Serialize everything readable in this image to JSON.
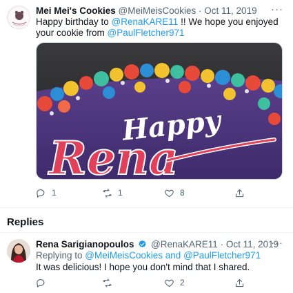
{
  "main_tweet": {
    "display_name": "Mei Mei's Cookies",
    "handle": "@MeiMeisCookies",
    "separator": "·",
    "date": "Oct 11, 2019",
    "more": "···",
    "text_before": "Happy birthday to ",
    "mention_1": "@RenaKARE11",
    "text_middle": " !! We hope you enjoyed your cookie from ",
    "mention_2": "@PaulFletcher971",
    "media_icon": "cake-photo",
    "actions": {
      "reply_count": "1",
      "retweet_count": "1",
      "like_count": "8"
    }
  },
  "replies_heading": "Replies",
  "reply_tweet": {
    "display_name": "Rena Sarigianopoulos",
    "handle": "@RenaKARE11",
    "separator": "·",
    "date": "Oct 11, 2019",
    "more": "···",
    "replying_prefix": "Replying to ",
    "replying_to_1": "@MeiMeisCookies",
    "replying_and": " and ",
    "replying_to_2": "@PaulFletcher971",
    "text": "It was delicious! I hope you don't mind that I shared.",
    "actions": {
      "like_count": "2"
    }
  },
  "colors": {
    "accent": "#1d9bf0",
    "secondary_text": "#536471",
    "primary_text": "#0f1419"
  }
}
